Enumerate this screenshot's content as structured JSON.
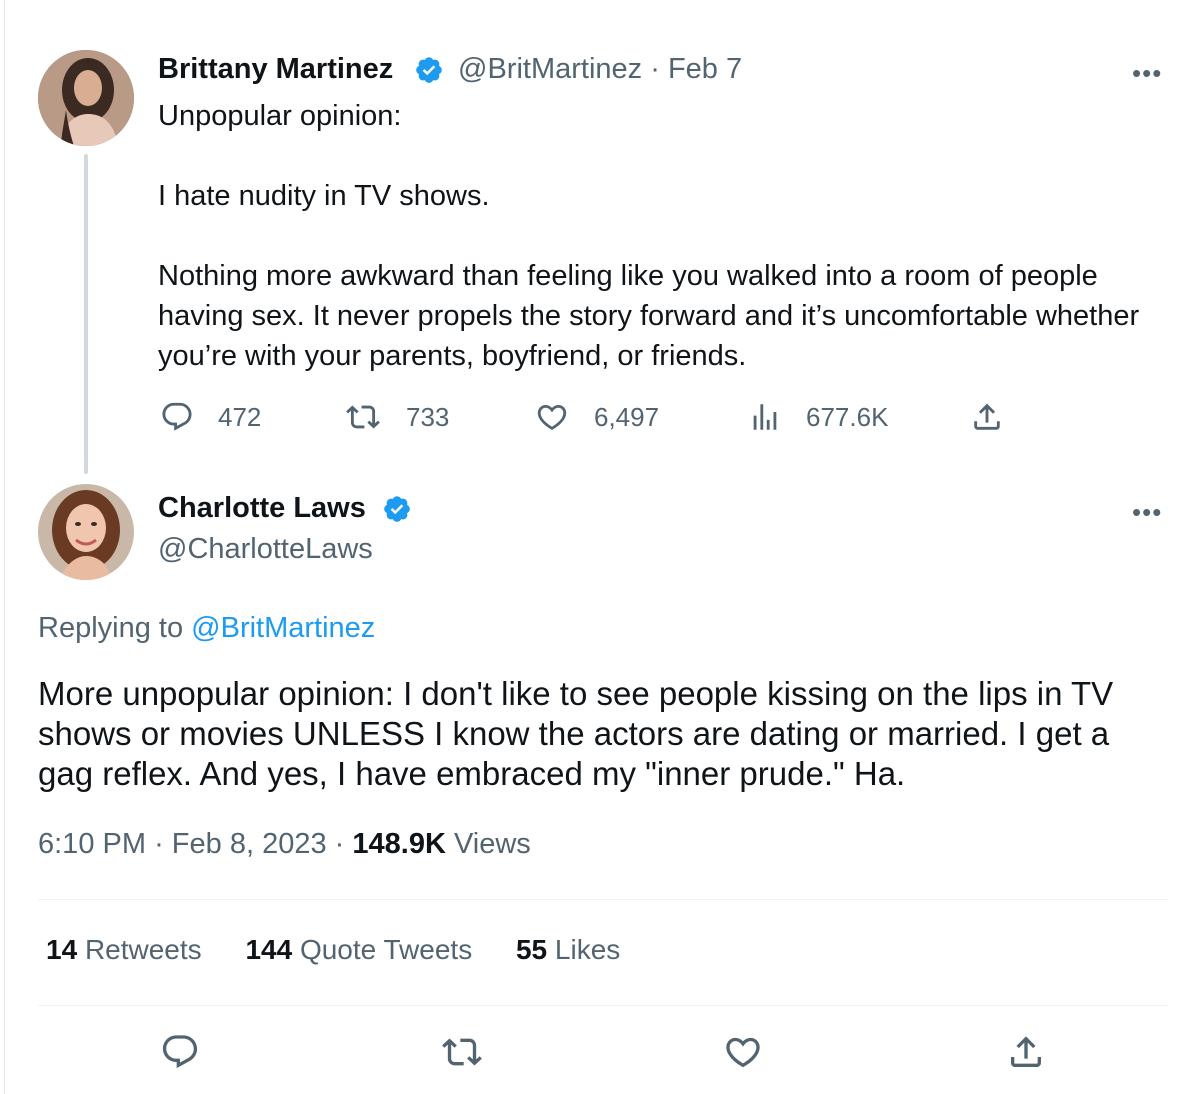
{
  "parent_tweet": {
    "author_name": "Brittany Martinez",
    "handle": "@BritMartinez",
    "date": "Feb 7",
    "separator": "·",
    "more_label": "•••",
    "text": "Unpopular opinion:\n\nI hate nudity in TV shows.\n\nNothing more awkward than feeling like you walked into a room of people having sex. It never propels the story forward and it’s uncomfortable whether you’re with your parents, boyfriend, or friends.",
    "stats": {
      "replies": "472",
      "retweets": "733",
      "likes": "6,497",
      "views": "677.6K"
    }
  },
  "reply_tweet": {
    "author_name": "Charlotte Laws",
    "handle": "@CharlotteLaws",
    "more_label": "•••",
    "replying_prefix": "Replying to",
    "replying_to": "@BritMartinez",
    "text": "More unpopular opinion: I don't like to see people kissing on the lips in TV shows or movies UNLESS I know the actors are dating or married. I get a gag reflex. And yes, I have embraced my \"inner prude.\" Ha.",
    "time": "6:10 PM",
    "date": "Feb 8, 2023",
    "separator": "·",
    "views_count": "148.9K",
    "views_label": "Views",
    "retweets_count": "14",
    "retweets_label": "Retweets",
    "quote_tweets_count": "144",
    "quote_tweets_label": "Quote Tweets",
    "likes_count": "55",
    "likes_label": "Likes"
  },
  "icons": {
    "verified": "verified-badge-icon",
    "reply": "reply-icon",
    "retweet": "retweet-icon",
    "like": "heart-icon",
    "views": "analytics-icon",
    "share": "share-icon"
  },
  "colors": {
    "accent": "#1d9bf0",
    "secondary_text": "#536471",
    "primary_text": "#0f1419",
    "thread_line": "#cfd9de"
  }
}
